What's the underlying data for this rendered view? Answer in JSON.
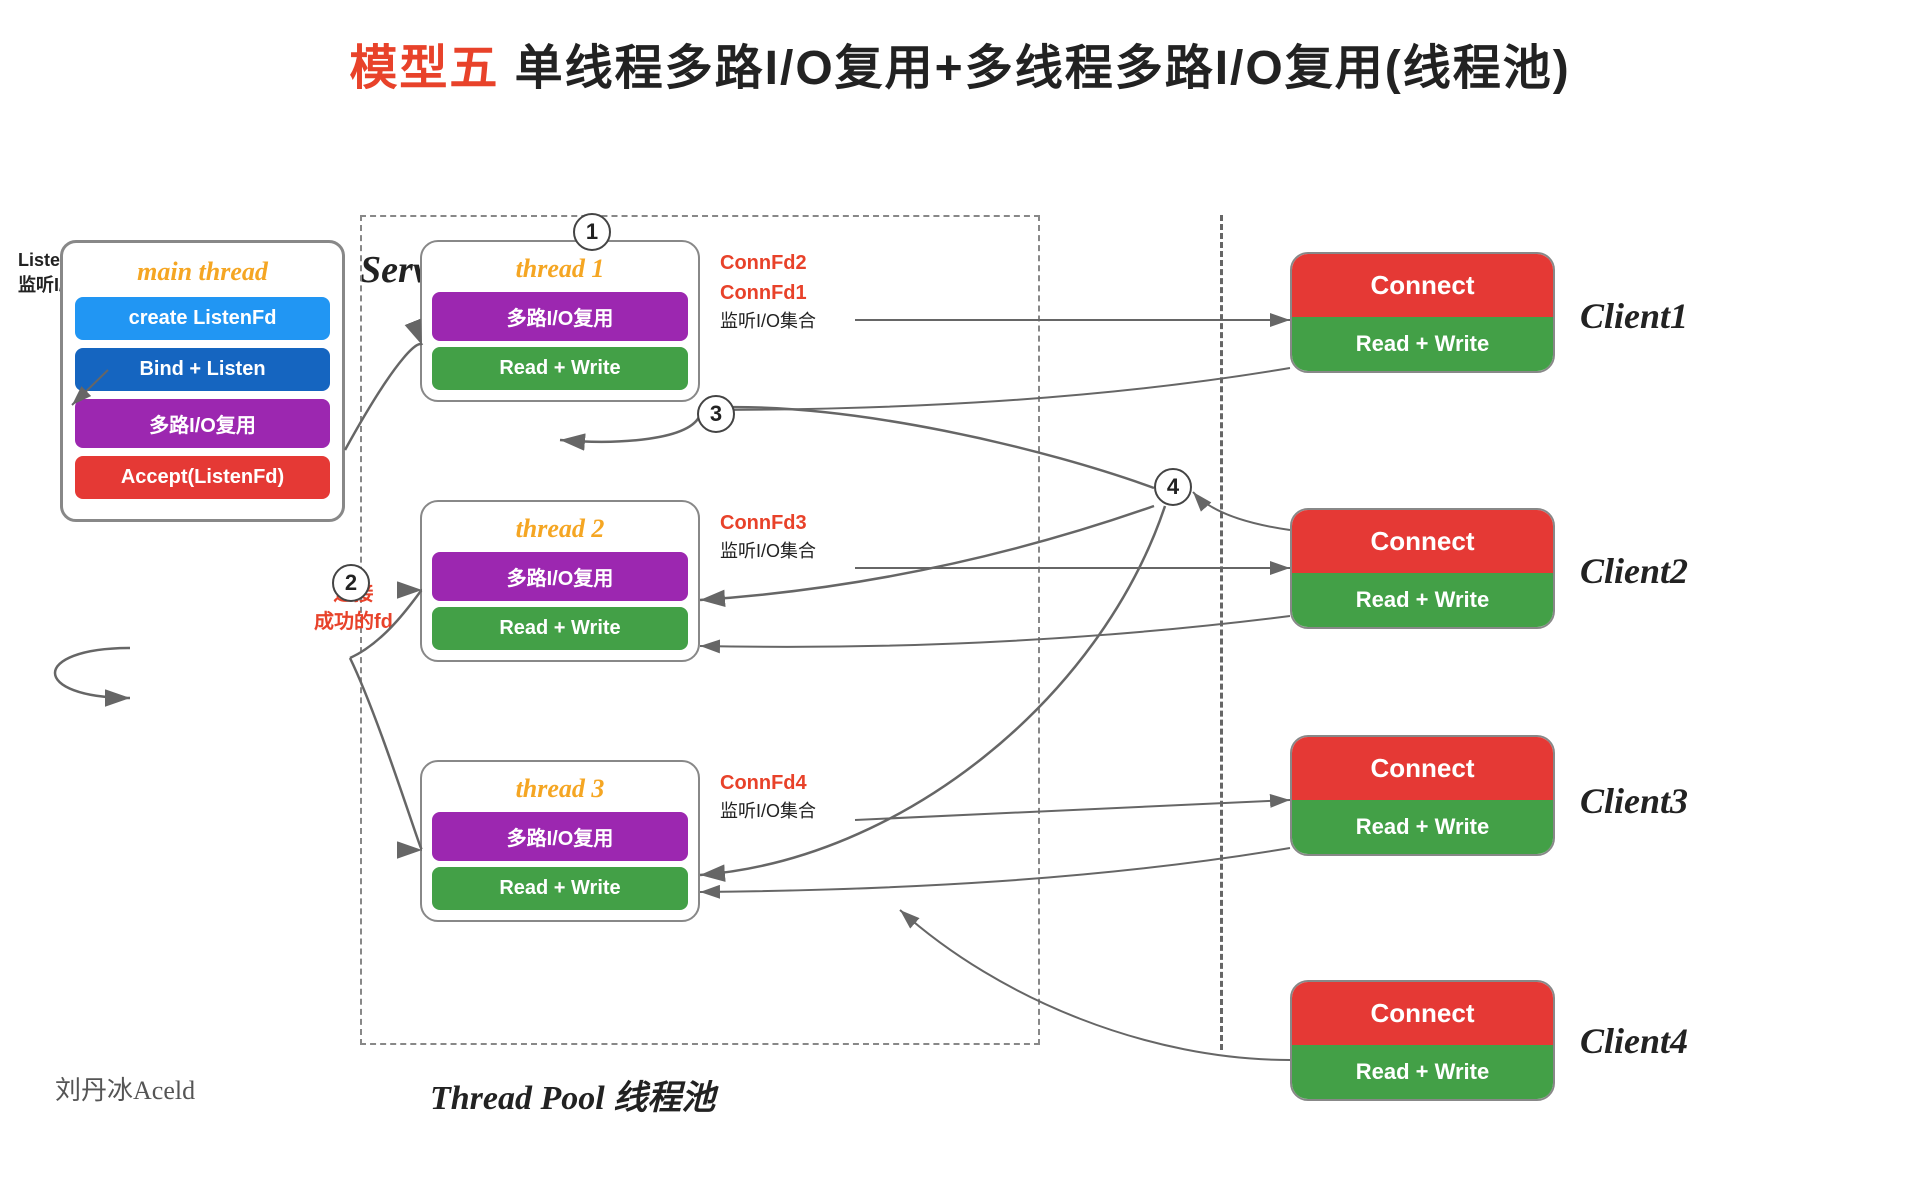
{
  "title": {
    "prefix": "模型五",
    "suffix": " 单线程多路I/O复用+多线程多路I/O复用(线程池)"
  },
  "listenFd": {
    "line1": "ListenFd",
    "line2": "监听I/O集合"
  },
  "mainThread": {
    "label": "main thread",
    "btn1": "create ListenFd",
    "btn2": "Bind + Listen",
    "btn3": "多路I/O复用",
    "btn4": "Accept(ListenFd)"
  },
  "server": {
    "label": "Server"
  },
  "threadPool": {
    "label": "Thread Pool 线程池"
  },
  "threads": [
    {
      "title": "thread 1",
      "row1": "多路I/O复用",
      "row2": "Read + Write",
      "connfdLine1": "ConnFd2",
      "connfdLine2": "ConnFd1",
      "connfdSub": "监听I/O集合"
    },
    {
      "title": "thread 2",
      "row1": "多路I/O复用",
      "row2": "Read + Write",
      "connfdLine1": "ConnFd3",
      "connfdLine2": "",
      "connfdSub": "监听I/O集合"
    },
    {
      "title": "thread 3",
      "row1": "多路I/O复用",
      "row2": "Read + Write",
      "connfdLine1": "ConnFd4",
      "connfdLine2": "",
      "connfdSub": "监听I/O集合"
    }
  ],
  "circleNums": [
    "1",
    "2",
    "3",
    "4"
  ],
  "connSuccessLabel": {
    "line1": "连接",
    "line2": "成功的fd"
  },
  "clients": [
    {
      "label": "Client1",
      "connect": "Connect",
      "rw": "Read + Write"
    },
    {
      "label": "Client2",
      "connect": "Connect",
      "rw": "Read + Write"
    },
    {
      "label": "Client3",
      "connect": "Connect",
      "rw": "Read + Write"
    },
    {
      "label": "Client4",
      "connect": "Connect",
      "rw": "Read + Write"
    }
  ],
  "watermark": "刘丹冰Aceld",
  "colors": {
    "accent": "#e8422a",
    "orange": "#f5a623",
    "blue": "#2196f3",
    "darkblue": "#1565c0",
    "purple": "#9c27b0",
    "red": "#e53935",
    "green": "#43a047"
  }
}
